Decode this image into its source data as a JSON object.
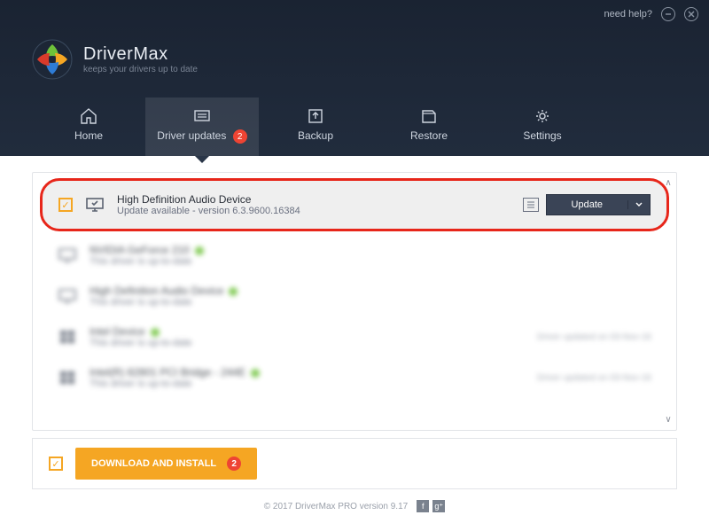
{
  "titlebar": {
    "help": "need help?"
  },
  "brand": {
    "name": "DriverMax",
    "tagline": "keeps your drivers up to date"
  },
  "tabs": {
    "home": "Home",
    "updates": "Driver updates",
    "updates_badge": "2",
    "backup": "Backup",
    "restore": "Restore",
    "settings": "Settings"
  },
  "rows": {
    "r0": {
      "title": "High Definition Audio Device",
      "sub": "Update available - version 6.3.9600.16384",
      "btn": "Update"
    },
    "r1": {
      "title": "NVIDIA GeForce 210",
      "sub": "This driver is up-to-date"
    },
    "r2": {
      "title": "High Definition Audio Device",
      "sub": "This driver is up-to-date"
    },
    "r3": {
      "title": "Intel Device",
      "sub": "This driver is up-to-date",
      "note": "Driver updated on 03-Nov-16"
    },
    "r4": {
      "title": "Intel(R) 82801 PCI Bridge - 244E",
      "sub": "This driver is up-to-date",
      "note": "Driver updated on 03-Nov-16"
    }
  },
  "footer": {
    "install": "DOWNLOAD AND INSTALL",
    "install_badge": "2",
    "copyright": "© 2017 DriverMax PRO version 9.17"
  }
}
